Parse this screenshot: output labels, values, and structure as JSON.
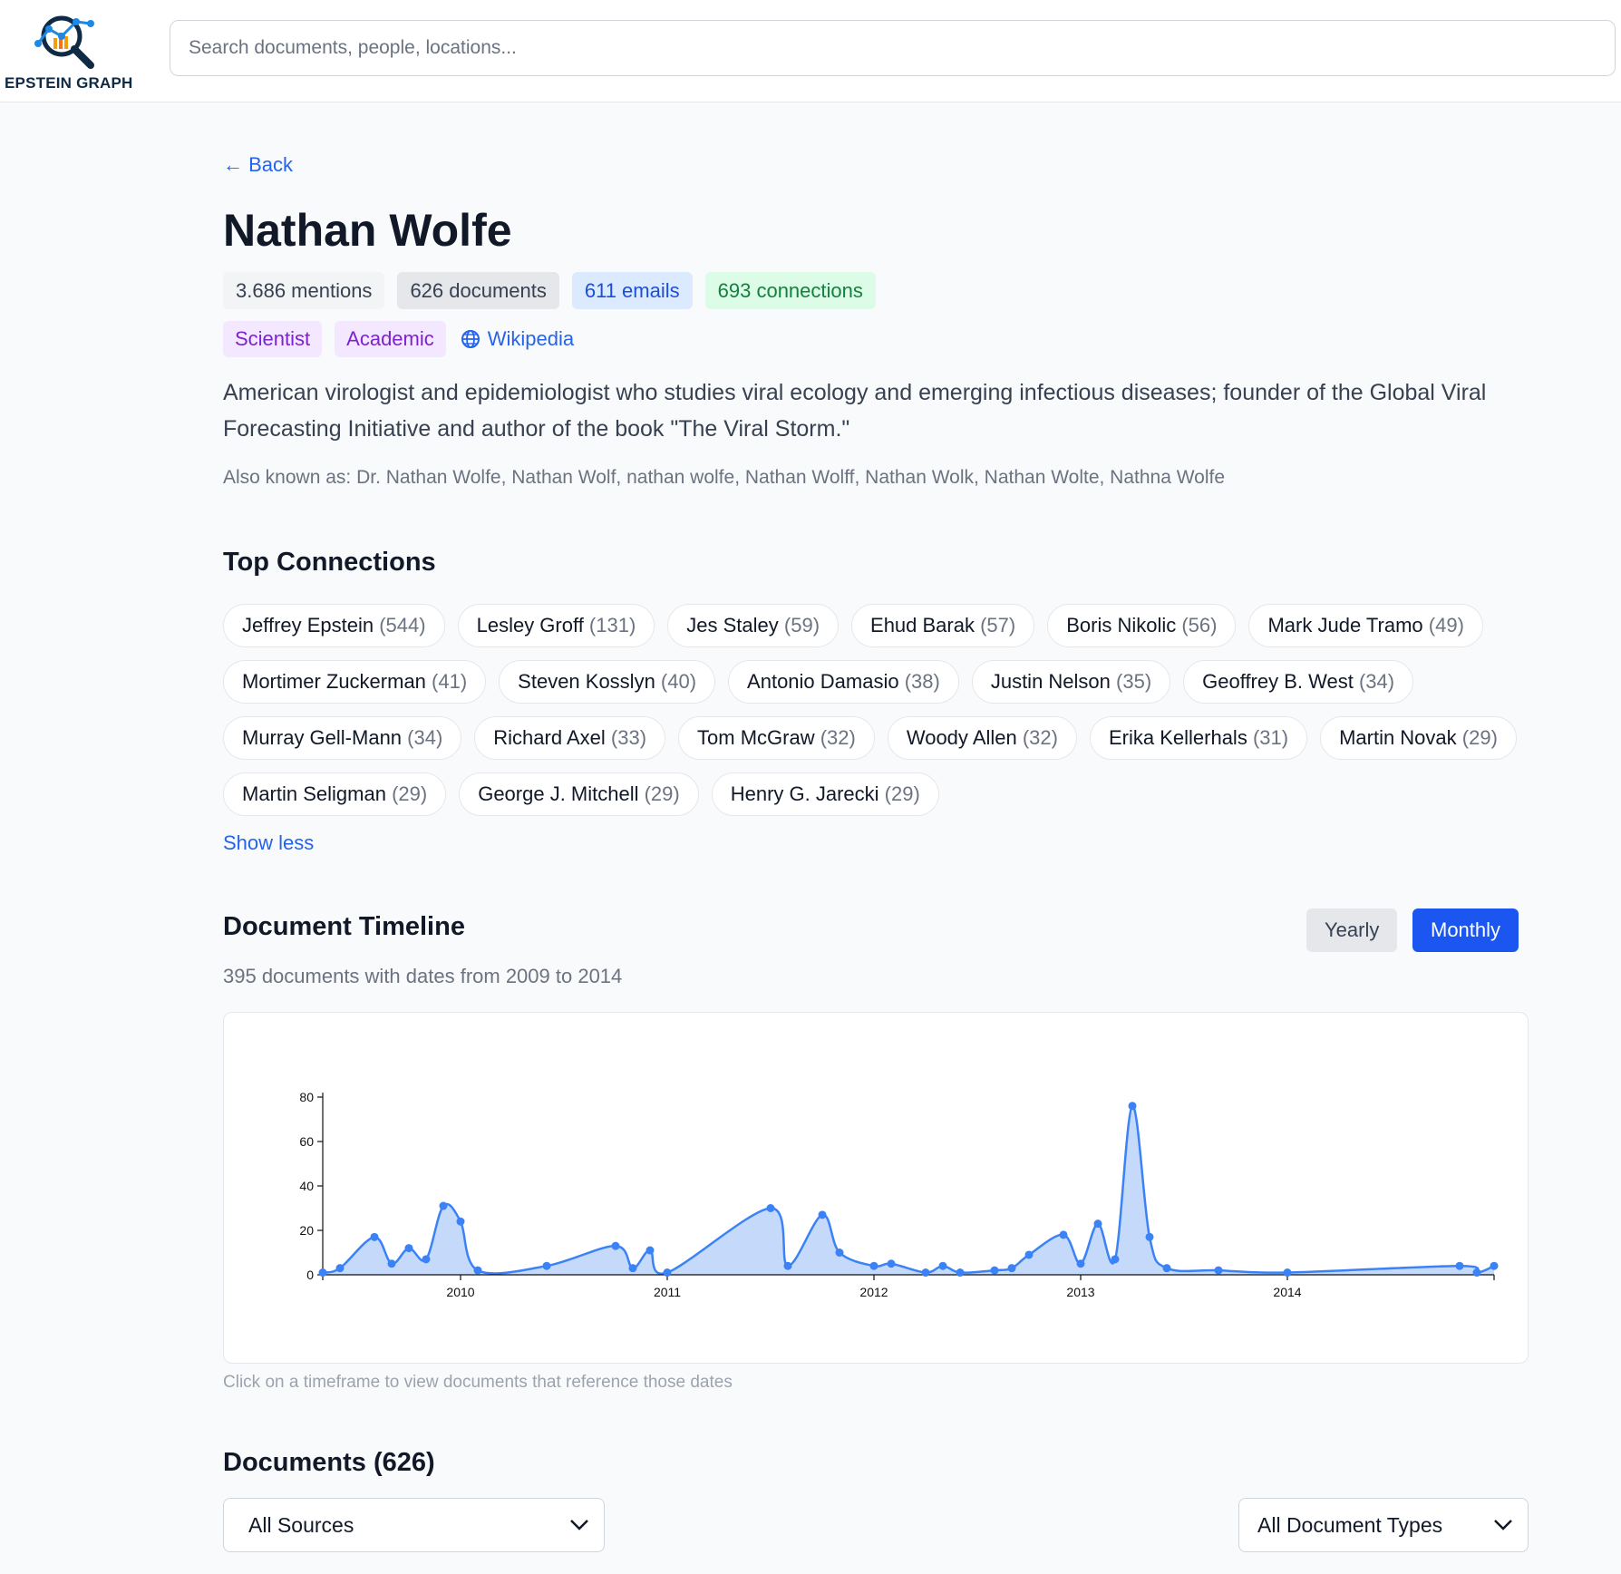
{
  "brand": {
    "name": "EPSTEIN GRAPH"
  },
  "search": {
    "placeholder": "Search documents, people, locations..."
  },
  "back_label": "← Back",
  "person": {
    "name": "Nathan Wolfe",
    "stats": {
      "mentions": "3.686 mentions",
      "documents": "626 documents",
      "emails": "611 emails",
      "connections": "693 connections"
    },
    "tags": [
      "Scientist",
      "Academic"
    ],
    "wikipedia_label": "Wikipedia",
    "description": "American virologist and epidemiologist who studies viral ecology and emerging infectious diseases; founder of the Global Viral Forecasting Initiative and author of the book \"The Viral Storm.\"",
    "aka": "Also known as: Dr. Nathan Wolfe, Nathan Wolf, nathan wolfe, Nathan Wolff, Nathan Wolk, Nathan Wolte, Nathna Wolfe"
  },
  "top_connections": {
    "title": "Top Connections",
    "items": [
      {
        "name": "Jeffrey Epstein",
        "count": "(544)"
      },
      {
        "name": "Lesley Groff",
        "count": "(131)"
      },
      {
        "name": "Jes Staley",
        "count": "(59)"
      },
      {
        "name": "Ehud Barak",
        "count": "(57)"
      },
      {
        "name": "Boris Nikolic",
        "count": "(56)"
      },
      {
        "name": "Mark Jude Tramo",
        "count": "(49)"
      },
      {
        "name": "Mortimer Zuckerman",
        "count": "(41)"
      },
      {
        "name": "Steven Kosslyn",
        "count": "(40)"
      },
      {
        "name": "Antonio Damasio",
        "count": "(38)"
      },
      {
        "name": "Justin Nelson",
        "count": "(35)"
      },
      {
        "name": "Geoffrey B. West",
        "count": "(34)"
      },
      {
        "name": "Murray Gell-Mann",
        "count": "(34)"
      },
      {
        "name": "Richard Axel",
        "count": "(33)"
      },
      {
        "name": "Tom McGraw",
        "count": "(32)"
      },
      {
        "name": "Woody Allen",
        "count": "(32)"
      },
      {
        "name": "Erika Kellerhals",
        "count": "(31)"
      },
      {
        "name": "Martin Novak",
        "count": "(29)"
      },
      {
        "name": "Martin Seligman",
        "count": "(29)"
      },
      {
        "name": "George J. Mitchell",
        "count": "(29)"
      },
      {
        "name": "Henry G. Jarecki",
        "count": "(29)"
      }
    ],
    "show_less": "Show less"
  },
  "timeline": {
    "title": "Document Timeline",
    "toggle_yearly": "Yearly",
    "toggle_monthly": "Monthly",
    "subtitle": "395 documents with dates from 2009 to 2014",
    "note": "Click on a timeframe to view documents that reference those dates"
  },
  "chart_data": {
    "type": "area",
    "title": "",
    "xlabel": "",
    "ylabel": "",
    "ylim": [
      0,
      80
    ],
    "yticks": [
      0,
      20,
      40,
      60,
      80
    ],
    "xticks": [
      "2010",
      "2011",
      "2012",
      "2013",
      "2014"
    ],
    "grid": false,
    "series": [
      {
        "points": [
          [
            "2009-05",
            1
          ],
          [
            "2009-06",
            3
          ],
          [
            "2009-08",
            17
          ],
          [
            "2009-09",
            5
          ],
          [
            "2009-10",
            12
          ],
          [
            "2009-11",
            7
          ],
          [
            "2009-12",
            31
          ],
          [
            "2010-01",
            24
          ],
          [
            "2010-02",
            2
          ],
          [
            "2010-06",
            4
          ],
          [
            "2010-10",
            13
          ],
          [
            "2010-11",
            3
          ],
          [
            "2010-12",
            11
          ],
          [
            "2011-01",
            1
          ],
          [
            "2011-07",
            30
          ],
          [
            "2011-08",
            4
          ],
          [
            "2011-10",
            27
          ],
          [
            "2011-11",
            10
          ],
          [
            "2012-01",
            4
          ],
          [
            "2012-02",
            5
          ],
          [
            "2012-04",
            1
          ],
          [
            "2012-05",
            4
          ],
          [
            "2012-06",
            1
          ],
          [
            "2012-08",
            2
          ],
          [
            "2012-09",
            3
          ],
          [
            "2012-10",
            9
          ],
          [
            "2012-12",
            18
          ],
          [
            "2013-01",
            5
          ],
          [
            "2013-02",
            23
          ],
          [
            "2013-03",
            7
          ],
          [
            "2013-04",
            76
          ],
          [
            "2013-05",
            17
          ],
          [
            "2013-06",
            3
          ],
          [
            "2013-09",
            2
          ],
          [
            "2014-01",
            1
          ],
          [
            "2014-11",
            4
          ],
          [
            "2014-12",
            1
          ],
          [
            "2015-01",
            4
          ]
        ]
      }
    ]
  },
  "documents": {
    "title": "Documents (626)",
    "source_select": "All Sources",
    "type_select": "All Document Types"
  }
}
